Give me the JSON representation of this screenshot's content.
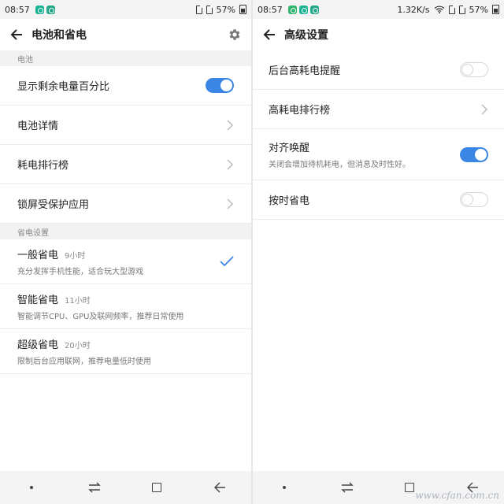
{
  "left": {
    "status": {
      "time": "08:57",
      "battery": "57%"
    },
    "title": "电池和省电",
    "battery_section": "电池",
    "battery_items": [
      {
        "label": "显示剩余电量百分比",
        "control": "toggle",
        "on": true
      },
      {
        "label": "电池详情",
        "control": "chevron"
      },
      {
        "label": "耗电排行榜",
        "control": "chevron"
      },
      {
        "label": "锁屏受保护应用",
        "control": "chevron"
      }
    ],
    "power_section": "省电设置",
    "modes": [
      {
        "title": "一般省电",
        "time": "9小时",
        "desc": "充分发挥手机性能，适合玩大型游戏",
        "selected": true
      },
      {
        "title": "智能省电",
        "time": "11小时",
        "desc": "智能调节CPU、GPU及联网频率，推荐日常使用",
        "selected": false
      },
      {
        "title": "超级省电",
        "time": "20小时",
        "desc": "限制后台应用联网，推荐电量低时使用",
        "selected": false
      }
    ]
  },
  "right": {
    "status": {
      "time": "08:57",
      "network": "1.32K/s",
      "battery": "57%"
    },
    "title": "高级设置",
    "items": [
      {
        "label": "后台高耗电提醒",
        "control": "toggle",
        "on": false
      },
      {
        "label": "高耗电排行榜",
        "control": "chevron"
      },
      {
        "label": "对齐唤醒",
        "desc": "关闭会增加待机耗电，但消息及时性好。",
        "control": "toggle",
        "on": true
      },
      {
        "label": "按时省电",
        "control": "toggle",
        "on": false
      }
    ],
    "watermark": "www.cfan.com.cn"
  },
  "colors": {
    "accent": "#3a86e4",
    "section_bg": "#f2f2f2"
  },
  "icons": {
    "back": "back-arrow-icon",
    "settings": "gear-icon",
    "chevron": "chevron-right-icon",
    "check": "checkmark-icon",
    "nav": [
      "menu-dot-icon",
      "switch-icon",
      "home-square-icon",
      "back-icon"
    ]
  }
}
